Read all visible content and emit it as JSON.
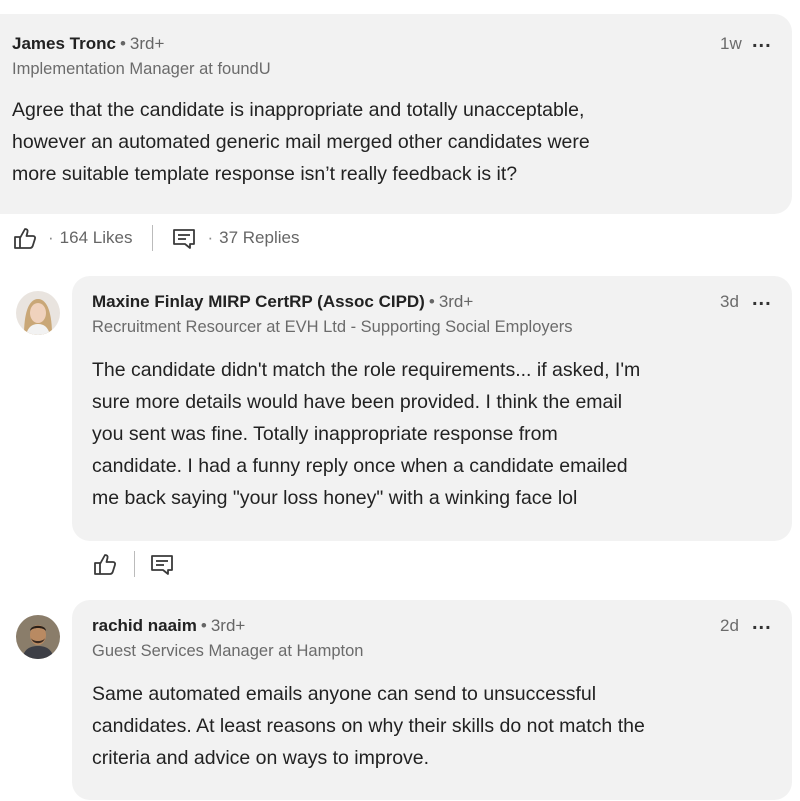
{
  "comments": [
    {
      "author": "James Tronc",
      "degree": "3rd+",
      "headline": "Implementation Manager at foundU",
      "time": "1w",
      "more": "...",
      "text_lines": [
        "Agree that the candidate is inappropriate and totally unacceptable,",
        "however an automated generic mail merged  other candidates were",
        "more suitable template response isn’t really feedback is it?"
      ],
      "likes": "164 Likes",
      "replies": "37 Replies"
    },
    {
      "author": "Maxine Finlay MIRP CertRP (Assoc CIPD)",
      "degree": "3rd+",
      "headline": "Recruitment Resourcer at EVH Ltd - Supporting Social Employers",
      "time": "3d",
      "more": "...",
      "text_lines": [
        "The candidate didn't match the role requirements... if asked, I'm",
        "sure more details would have been provided. I think the email",
        "you sent was fine. Totally inappropriate response from",
        "candidate. I had a funny reply once when a candidate emailed",
        "me back saying \"your loss honey\" with a winking face lol"
      ]
    },
    {
      "author": "rachid naaim",
      "degree": "3rd+",
      "headline": "Guest Services Manager at Hampton",
      "time": "2d",
      "more": "...",
      "text_lines": [
        "Same automated emails anyone can send to unsuccessful",
        "candidates. At least reasons on why their skills do not match the",
        "criteria and advice on ways to improve."
      ]
    }
  ],
  "icons": {
    "like": "thumbs-up-icon",
    "reply": "reply-icon",
    "more": "more-options-icon"
  },
  "colors": {
    "bubble_bg": "#f2f2f2",
    "secondary_text": "#6b6b6b"
  }
}
